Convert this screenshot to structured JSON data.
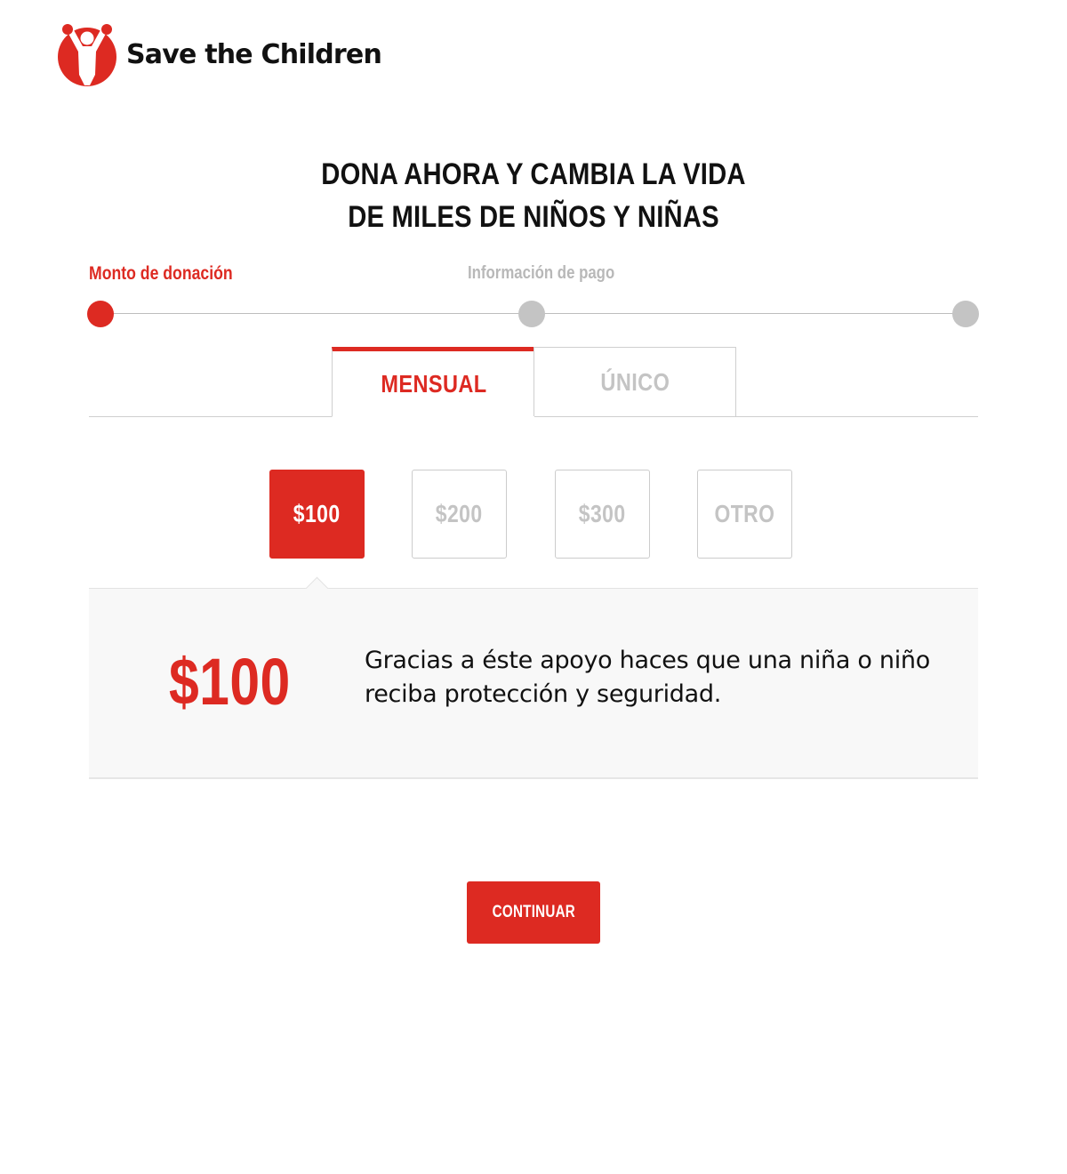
{
  "brand": {
    "name": "Save the Children",
    "logo_icon": "child-with-raised-arms-logo",
    "color": "#dd2a22"
  },
  "headline": {
    "line1": "DONA AHORA Y CAMBIA LA VIDA",
    "line2": "DE MILES DE NIÑOS Y NIÑAS"
  },
  "stepper": {
    "steps": [
      {
        "label": "Monto de donación",
        "state": "active"
      },
      {
        "label": "Información de pago",
        "state": "inactive"
      },
      {
        "label": "",
        "state": "inactive"
      }
    ]
  },
  "tabs": [
    {
      "label": "MENSUAL",
      "selected": true
    },
    {
      "label": "ÚNICO",
      "selected": false
    }
  ],
  "amounts": [
    {
      "label": "$100",
      "selected": true
    },
    {
      "label": "$200",
      "selected": false
    },
    {
      "label": "$300",
      "selected": false
    },
    {
      "label": "OTRO",
      "selected": false
    }
  ],
  "panel": {
    "amount": "$100",
    "description": "Gracias a éste apoyo haces que una niña o niño reciba protección y seguridad."
  },
  "continue_button": {
    "label": "CONTINUAR"
  },
  "colors": {
    "accent": "#dd2a22",
    "inactive": "#c4c4c4",
    "panel_bg": "#f8f8f8"
  }
}
